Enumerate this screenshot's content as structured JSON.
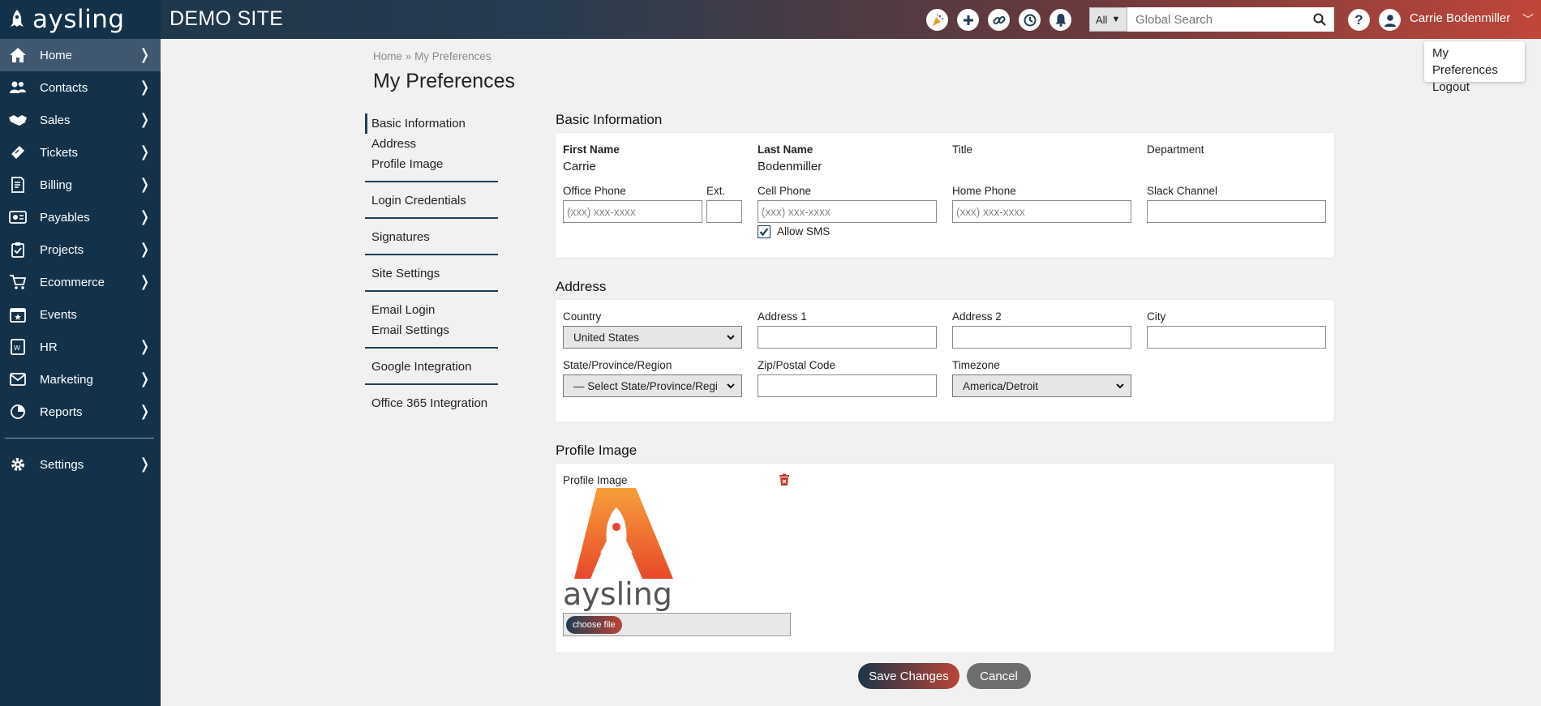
{
  "app": {
    "logo_text": "aysling",
    "site_title": "DEMO SITE"
  },
  "topbar": {
    "icons": [
      "party-icon",
      "plus-icon",
      "link-icon",
      "history-icon",
      "bell-icon"
    ],
    "search_scope": "All",
    "search_placeholder": "Global Search",
    "help_label": "?",
    "user_name": "Carrie Bodenmiller"
  },
  "user_menu": {
    "items": [
      "My Preferences",
      "Logout"
    ]
  },
  "sidebar": {
    "items": [
      {
        "label": "Home",
        "icon": "home-icon"
      },
      {
        "label": "Contacts",
        "icon": "contacts-icon"
      },
      {
        "label": "Sales",
        "icon": "handshake-icon"
      },
      {
        "label": "Tickets",
        "icon": "ticket-icon"
      },
      {
        "label": "Billing",
        "icon": "billing-icon"
      },
      {
        "label": "Payables",
        "icon": "payables-icon"
      },
      {
        "label": "Projects",
        "icon": "clipboard-icon"
      },
      {
        "label": "Ecommerce",
        "icon": "cart-icon"
      },
      {
        "label": "Events",
        "icon": "calendar-icon"
      },
      {
        "label": "HR",
        "icon": "hr-icon"
      },
      {
        "label": "Marketing",
        "icon": "mail-icon"
      },
      {
        "label": "Reports",
        "icon": "reports-icon"
      }
    ],
    "settings_label": "Settings",
    "chevron": "❭"
  },
  "page": {
    "breadcrumb_home": "Home",
    "breadcrumb_sep": "»",
    "breadcrumb_current": "My Preferences",
    "title": "My Preferences"
  },
  "subnav": {
    "groups": [
      [
        "Basic Information",
        "Address",
        "Profile Image"
      ],
      [
        "Login Credentials"
      ],
      [
        "Signatures"
      ],
      [
        "Site Settings"
      ],
      [
        "Email Login",
        "Email Settings"
      ],
      [
        "Google Integration"
      ],
      [
        "Office 365 Integration"
      ]
    ]
  },
  "basic": {
    "title": "Basic Information",
    "first_name_label": "First Name",
    "first_name": "Carrie",
    "last_name_label": "Last Name",
    "last_name": "Bodenmiller",
    "title_label": "Title",
    "department_label": "Department",
    "office_phone_label": "Office Phone",
    "office_phone_placeholder": "(xxx) xxx-xxxx",
    "ext_label": "Ext.",
    "cell_phone_label": "Cell Phone",
    "cell_phone_placeholder": "(xxx) xxx-xxxx",
    "home_phone_label": "Home Phone",
    "home_phone_placeholder": "(xxx) xxx-xxxx",
    "slack_label": "Slack Channel",
    "allow_sms_label": "Allow SMS",
    "allow_sms_checked": true
  },
  "address": {
    "title": "Address",
    "country_label": "Country",
    "country_value": "United States",
    "address1_label": "Address 1",
    "address2_label": "Address 2",
    "city_label": "City",
    "state_label": "State/Province/Region",
    "state_value": "— Select State/Province/Regi",
    "zip_label": "Zip/Postal Code",
    "timezone_label": "Timezone",
    "timezone_value": "America/Detroit"
  },
  "profile_image": {
    "title": "Profile Image",
    "field_label": "Profile Image",
    "image_wordmark": "aysling",
    "choose_file_label": "choose file"
  },
  "actions": {
    "save_label": "Save Changes",
    "cancel_label": "Cancel"
  }
}
